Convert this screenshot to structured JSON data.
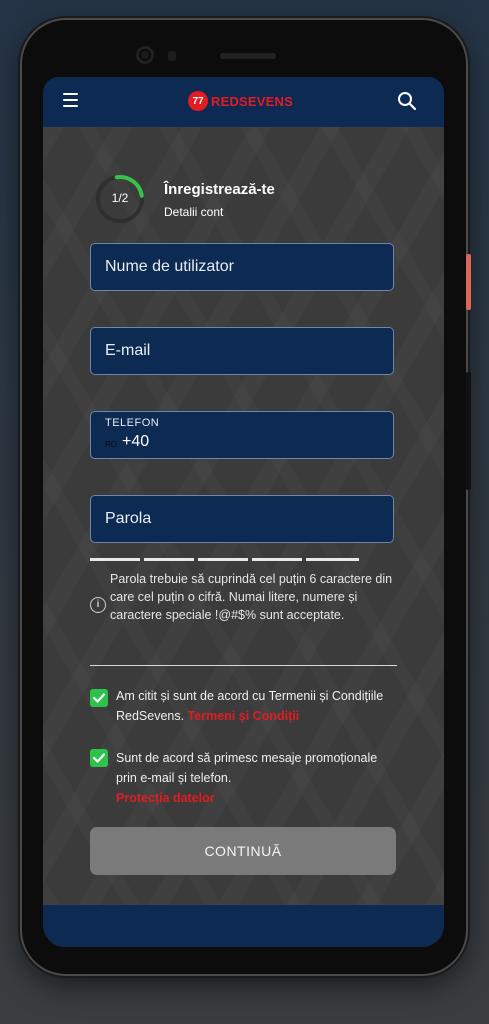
{
  "header": {
    "logo_badge": "77",
    "logo_text": "REDSEVENS"
  },
  "registration": {
    "progress_label": "1/2",
    "progress_fraction": 0.5,
    "title": "Înregistrează-te",
    "subtitle": "Detalii cont"
  },
  "form": {
    "username_placeholder": "Nume de utilizator",
    "email_placeholder": "E-mail",
    "phone_label": "TELEFON",
    "phone_country": "RO",
    "phone_prefix": "+40",
    "password_placeholder": "Parola",
    "password_hint": "Parola trebuie să cuprindă cel puțin 6 caractere din care cel puțin o cifră. Numai litere, numere și caractere speciale !@#$% sunt acceptate.",
    "terms_text": "Am citit și sunt de acord cu Termenii și Condițiile RedSevens.",
    "terms_link": "Termeni și Condiții",
    "terms_checked": true,
    "marketing_text": "Sunt de acord să primesc mesaje promoționale prin e-mail și telefon.",
    "marketing_link": "Protecția datelor",
    "marketing_checked": true,
    "continue_label": "CONTINUĂ"
  },
  "colors": {
    "brand_red": "#e31b23",
    "navy": "#0c2a52",
    "check_green": "#2ec24a",
    "progress_green": "#39c24a"
  }
}
